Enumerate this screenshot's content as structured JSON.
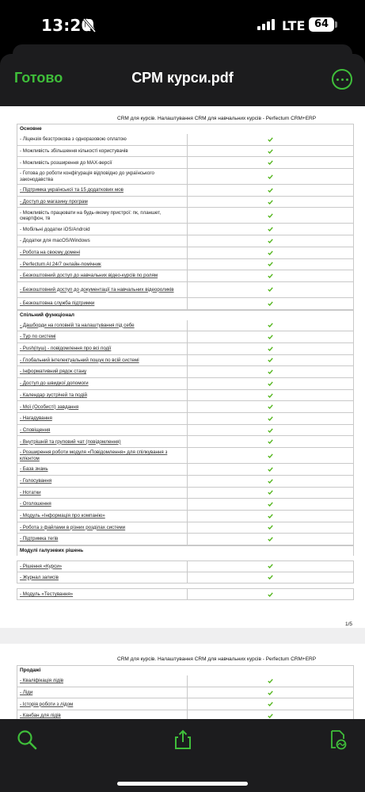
{
  "status_bar": {
    "time": "13:20",
    "network": "LTE",
    "battery": "64"
  },
  "nav": {
    "done_label": "Готово",
    "title": "СРМ курси.pdf",
    "accent_color": "#3fbe3a",
    "more_icon": "ellipsis-circle-icon"
  },
  "document": {
    "header": "CRM для курсів. Налаштування CRM для навчальних курсів - Perfectum CRM+ERP",
    "page1": {
      "page_number": "1/5",
      "rows": [
        {
          "type": "section",
          "label": "Основне"
        },
        {
          "label": "- Ліцензія безстрокова з одноразовою оплатою",
          "check": true
        },
        {
          "label": "- Можливість збільшення кількості користувачів",
          "check": true
        },
        {
          "label": "- Можливість розширення до MAX-версії",
          "check": true
        },
        {
          "label": "- Готова до роботи конфігурація відповідно до українського законодавства",
          "check": true,
          "tall": true
        },
        {
          "label": "- Підтримка української та 15 додаткових мов",
          "check": true,
          "u": true
        },
        {
          "label": "- Доступ до магазину програм",
          "check": true,
          "u": true
        },
        {
          "label": "- Можливість працювати на будь-якому пристрої: пк, планшет, смартфон, тв",
          "check": true,
          "tall": true
        },
        {
          "label": "- Мобільні додатки iOS/Android",
          "check": true
        },
        {
          "label": "- Додатки для macOS/Windows",
          "check": true
        },
        {
          "label": "- Робота на своєму домені",
          "check": true,
          "u": true
        },
        {
          "label": "- Perfectum AI 24/7 онлайн-помічник",
          "check": true,
          "u": true
        },
        {
          "label": "- Безкоштовний доступ до навчальних відео-курсів по ролям",
          "check": true,
          "u": true
        },
        {
          "label": "- Безкоштовний доступ до документації та навчальних відеороликів",
          "check": true,
          "u": true,
          "tall": true
        },
        {
          "label": "- Безкоштовна служба підтримки",
          "check": true,
          "u": true
        },
        {
          "type": "section",
          "label": "Спільний функціонал"
        },
        {
          "label": "- Дашборди на головній та налаштування під себе",
          "check": true,
          "u": true
        },
        {
          "label": "- Тур по системі",
          "check": true,
          "u": true
        },
        {
          "label": "- Push(пуш) - повідомлення про всі події",
          "check": true,
          "u": true
        },
        {
          "label": "- Глобальний інтелектуальний пошук по всій системі",
          "check": true,
          "u": true
        },
        {
          "label": "- Інформативний рядок стану",
          "check": true,
          "u": true
        },
        {
          "label": "- Доступ до швидкої допомоги",
          "check": true,
          "u": true
        },
        {
          "label": "- Календар зустрічей та подій",
          "check": true,
          "u": true
        },
        {
          "label": "- Мої (Особисті) завдання",
          "check": true,
          "u": true
        },
        {
          "label": "- Нагадування",
          "check": true,
          "u": true
        },
        {
          "label": "- Сповіщення",
          "check": true,
          "u": true
        },
        {
          "label": "- Внутрішній та груповий чат (повідомлення)",
          "check": true,
          "u": true
        },
        {
          "label": "- Розширення роботи модуля «Повідомлення» для спілкування з клієнтом",
          "check": true,
          "u": true,
          "tall": true
        },
        {
          "label": "- База знань",
          "check": true,
          "u": true
        },
        {
          "label": "- Голосування",
          "check": true,
          "u": true
        },
        {
          "label": "- Нотатки",
          "check": true,
          "u": true
        },
        {
          "label": "- Оголошення",
          "check": true,
          "u": true
        },
        {
          "label": "- Модуль «Інформація про компанію»",
          "check": true,
          "u": true
        },
        {
          "label": "- Робота з файлами в різних розділах системи",
          "check": true,
          "u": true
        },
        {
          "label": "- Підтримка тегів",
          "check": true,
          "u": true
        },
        {
          "type": "section",
          "label": "Модулі галузевих рішень"
        },
        {
          "type": "gap"
        },
        {
          "label": "- Рішення «Курси»",
          "check": true,
          "u": true
        },
        {
          "label": "- Журнал записів",
          "check": true,
          "u": true
        },
        {
          "type": "gap"
        },
        {
          "label": "- Модуль «Тестування»",
          "check": true,
          "u": true
        }
      ]
    },
    "page2": {
      "rows": [
        {
          "type": "section",
          "label": "Продажі"
        },
        {
          "label": "- Кваліфікація лідів",
          "check": true,
          "u": true
        },
        {
          "label": "- Ліди",
          "check": true,
          "u": true
        },
        {
          "label": "- Історія роботи з лідом",
          "check": true,
          "u": true
        },
        {
          "label": "- Канбан для лідів",
          "check": true,
          "u": true
        }
      ]
    }
  },
  "toolbar": {
    "items": [
      {
        "icon": "search-icon"
      },
      {
        "icon": "share-icon"
      },
      {
        "icon": "sign-document-icon"
      }
    ]
  }
}
